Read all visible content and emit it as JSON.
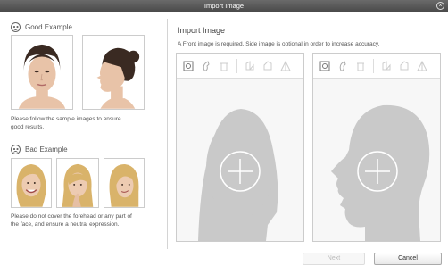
{
  "window": {
    "title": "Import Image",
    "close_glyph": "×"
  },
  "good": {
    "heading": "Good Example",
    "note_line1": "Please follow the sample images to ensure",
    "note_line2": "good results."
  },
  "bad": {
    "heading": "Bad Example",
    "note_line1": "Please do not cover the forehead or any part of",
    "note_line2": "the face, and ensure a neutral expression."
  },
  "import": {
    "title": "Import Image",
    "description": "A Front image is required. Side image is optional in order to increase accuracy.",
    "front_toolbar": [
      "import-photo-icon",
      "adjust-icon",
      "trash-icon",
      "flip-icon",
      "flip-alt-icon",
      "warp-icon"
    ],
    "side_toolbar": [
      "import-photo-icon",
      "adjust-icon",
      "trash-icon",
      "flip-icon",
      "flip-alt-icon",
      "warp-icon"
    ]
  },
  "buttons": {
    "next": "Next",
    "cancel": "Cancel"
  },
  "colors": {
    "placeholder_head": "#c9c9c9",
    "title_bar": "#555555",
    "hair_blonde": "#d9b36a",
    "hair_dark": "#3a2a22"
  }
}
